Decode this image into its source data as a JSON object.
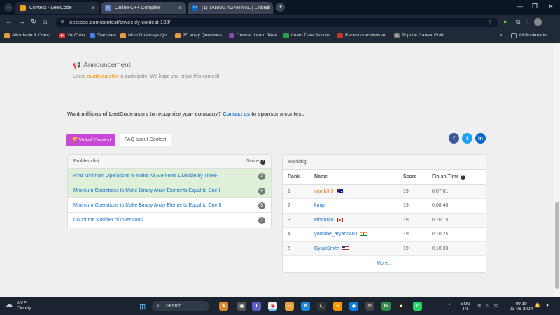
{
  "browser": {
    "tabs": [
      {
        "title": "Contest - LeetCode",
        "active": true
      },
      {
        "title": "Online C++ Compiler",
        "active": false
      },
      {
        "title": "(1) TANNU AGARWAL | Linkedi",
        "active": false
      }
    ],
    "url": "leetcode.com/contest/biweekly-contest-133/",
    "bookmarks": [
      "Affordable & Comp...",
      "YouTube",
      "Translate",
      "Must Do Arrays Qu...",
      "2D array Questions...",
      "Course: Learn JAVA...",
      "Learn Data Structur...",
      "Recent questions an...",
      "Popular Career Guid..."
    ],
    "all_bookmarks": "All Bookmarks"
  },
  "announcement": {
    "title": "Announcement",
    "text_before": "Users ",
    "text_bold": "must register",
    "text_after": " to participate. We hope you enjoy this contest!"
  },
  "sponsor": {
    "before": "Want millions of LeetCode users to ",
    "italic": "recognize your company",
    "mid": "? ",
    "link": "Contact us",
    "after": " to sponsor a contest."
  },
  "buttons": {
    "virtual": "Virtual Contest",
    "faq": "FAQ about Contest"
  },
  "social": [
    "f",
    "t",
    "in"
  ],
  "problems": {
    "header": "Problem list",
    "score_label": "Score",
    "items": [
      {
        "title": "Find Minimum Operations to Make All Elements Divisible by Three",
        "score": "3",
        "solved": true
      },
      {
        "title": "Minimum Operations to Make Binary Array Elements Equal to One I",
        "score": "4",
        "solved": true
      },
      {
        "title": "Minimum Operations to Make Binary Array Elements Equal to One II",
        "score": "5",
        "solved": false
      },
      {
        "title": "Count the Number of Inversions",
        "score": "7",
        "solved": false
      }
    ]
  },
  "ranking": {
    "header": "Ranking",
    "columns": [
      "Rank",
      "Name",
      "Score",
      "Finish Time"
    ],
    "rows": [
      {
        "rank": "1",
        "name": "numb3r5",
        "score": "19",
        "time": "0:07:01",
        "flag": "au"
      },
      {
        "rank": "2",
        "name": "kmjp",
        "score": "19",
        "time": "0:08:40",
        "flag": ""
      },
      {
        "rank": "3",
        "name": "ethanrao",
        "score": "19",
        "time": "0:10:15",
        "flag": "ca"
      },
      {
        "rank": "4",
        "name": "youtube_aryanc403",
        "score": "19",
        "time": "0:10:25",
        "flag": "in"
      },
      {
        "rank": "5",
        "name": "DylanSmith",
        "score": "19",
        "time": "0:10:33",
        "flag": "us"
      }
    ],
    "more": "More..."
  },
  "taskbar": {
    "temp": "90°F",
    "weather": "Cloudy",
    "search": "Search",
    "lang1": "ENG",
    "lang2": "IN",
    "time": "09:19",
    "date": "23-06-2024"
  },
  "colors": {
    "accent_purple": "#c849d6",
    "link_blue": "#1a73c9",
    "solved_green": "#dff0d8",
    "orange": "#f0a020"
  }
}
